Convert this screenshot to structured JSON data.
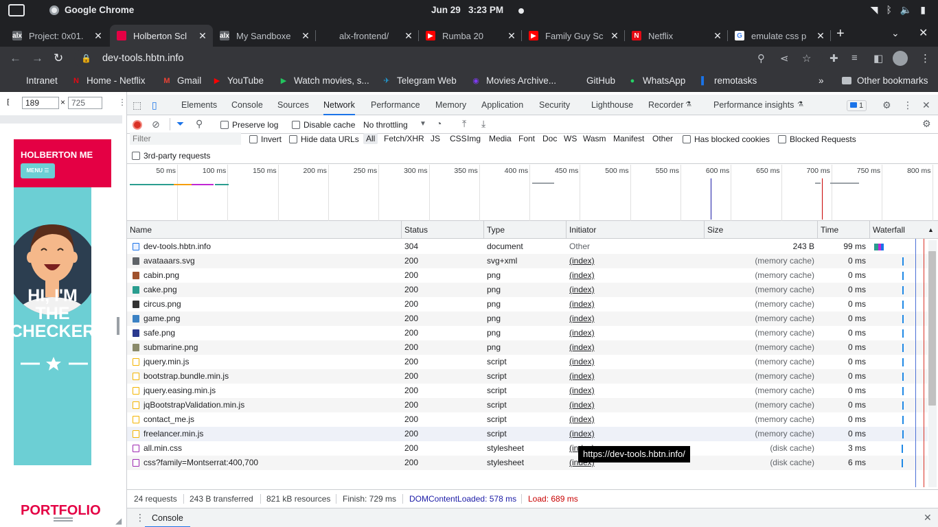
{
  "os": {
    "app_name": "Google Chrome",
    "date": "Jun 29",
    "time": "3:23 PM"
  },
  "browser": {
    "tabs": [
      {
        "title": "Project: 0x01.",
        "color": "#5f6368",
        "icon": "alx-icon",
        "glyph": "alx"
      },
      {
        "title": "Holberton Scl",
        "color": "#e40044",
        "icon": "holberton-icon",
        "glyph": ""
      },
      {
        "title": "My Sandboxe",
        "color": "#5f6368",
        "icon": "alx-icon",
        "glyph": "alx"
      },
      {
        "title": "alx-frontend/",
        "color": "#202124",
        "icon": "github-icon",
        "glyph": ""
      },
      {
        "title": "Rumba 20",
        "color": "#ff0000",
        "icon": "youtube-icon",
        "glyph": "▶"
      },
      {
        "title": "Family Guy Sc",
        "color": "#ff0000",
        "icon": "youtube-icon",
        "glyph": "▶"
      },
      {
        "title": "Netflix",
        "color": "#e50914",
        "icon": "netflix-icon",
        "glyph": "N"
      },
      {
        "title": "emulate css p",
        "color": "#ffffff",
        "icon": "google-icon",
        "glyph": "G"
      }
    ],
    "url": "dev-tools.hbtn.info",
    "bookmarks": [
      {
        "label": "Intranet",
        "icon": "alx-icon"
      },
      {
        "label": "Home - Netflix",
        "icon": "netflix-icon"
      },
      {
        "label": "Gmail",
        "icon": "gmail-icon"
      },
      {
        "label": "YouTube",
        "icon": "youtube-icon"
      },
      {
        "label": "Watch movies, s...",
        "icon": "play-icon"
      },
      {
        "label": "Telegram Web",
        "icon": "telegram-icon"
      },
      {
        "label": "Movies Archive...",
        "icon": "movies-icon"
      },
      {
        "label": "GitHub",
        "icon": "github-icon"
      },
      {
        "label": "WhatsApp",
        "icon": "whatsapp-icon"
      },
      {
        "label": "remotasks",
        "icon": "remotasks-icon"
      }
    ],
    "other_bookmarks": "Other bookmarks"
  },
  "device": {
    "width": "189",
    "height": "725",
    "separator": "×"
  },
  "emulated_page": {
    "brand": "HOLBERTON ME",
    "menu_label": "MENU ☰",
    "heading": [
      "HI, I'M",
      "THE",
      "CHECKER"
    ],
    "section": "PORTFOLIO"
  },
  "devtools": {
    "tabs": [
      "Elements",
      "Console",
      "Sources",
      "Network",
      "Performance",
      "Memory",
      "Application",
      "Security",
      "Lighthouse",
      "Recorder",
      "Performance insights"
    ],
    "active_tab": "Network",
    "issues_count": "1",
    "toolbar": {
      "preserve_log": "Preserve log",
      "disable_cache": "Disable cache",
      "throttling": "No throttling"
    },
    "filter": {
      "placeholder": "Filter",
      "invert": "Invert",
      "hide_data_urls": "Hide data URLs",
      "types": [
        "All",
        "Fetch/XHR",
        "JS",
        "CSS",
        "Img",
        "Media",
        "Font",
        "Doc",
        "WS",
        "Wasm",
        "Manifest",
        "Other"
      ],
      "has_blocked_cookies": "Has blocked cookies",
      "blocked_requests": "Blocked Requests",
      "third_party": "3rd-party requests"
    },
    "overview_ticks": [
      "50 ms",
      "100 ms",
      "150 ms",
      "200 ms",
      "250 ms",
      "300 ms",
      "350 ms",
      "400 ms",
      "450 ms",
      "500 ms",
      "550 ms",
      "600 ms",
      "650 ms",
      "700 ms",
      "750 ms",
      "800 ms"
    ],
    "columns": [
      "Name",
      "Status",
      "Type",
      "Initiator",
      "Size",
      "Time",
      "Waterfall"
    ],
    "requests": [
      {
        "name": "dev-tools.hbtn.info",
        "status": "304",
        "type": "document",
        "initiator": "Other",
        "size": "243 B",
        "time": "99 ms",
        "icon": "document-icon",
        "icolor": "#1a73e8"
      },
      {
        "name": "avataaars.svg",
        "status": "200",
        "type": "svg+xml",
        "initiator": "(index)",
        "size": "(memory cache)",
        "time": "0 ms",
        "icon": "image-icon",
        "icolor": "#5f6368"
      },
      {
        "name": "cabin.png",
        "status": "200",
        "type": "png",
        "initiator": "(index)",
        "size": "(memory cache)",
        "time": "0 ms",
        "icon": "image-icon",
        "icolor": "#a0522d"
      },
      {
        "name": "cake.png",
        "status": "200",
        "type": "png",
        "initiator": "(index)",
        "size": "(memory cache)",
        "time": "0 ms",
        "icon": "image-icon",
        "icolor": "#2a9d8f"
      },
      {
        "name": "circus.png",
        "status": "200",
        "type": "png",
        "initiator": "(index)",
        "size": "(memory cache)",
        "time": "0 ms",
        "icon": "image-icon",
        "icolor": "#333333"
      },
      {
        "name": "game.png",
        "status": "200",
        "type": "png",
        "initiator": "(index)",
        "size": "(memory cache)",
        "time": "0 ms",
        "icon": "image-icon",
        "icolor": "#3b82c4"
      },
      {
        "name": "safe.png",
        "status": "200",
        "type": "png",
        "initiator": "(index)",
        "size": "(memory cache)",
        "time": "0 ms",
        "icon": "image-icon",
        "icolor": "#2b3a8f"
      },
      {
        "name": "submarine.png",
        "status": "200",
        "type": "png",
        "initiator": "(index)",
        "size": "(memory cache)",
        "time": "0 ms",
        "icon": "image-icon",
        "icolor": "#8a8a6a"
      },
      {
        "name": "jquery.min.js",
        "status": "200",
        "type": "script",
        "initiator": "(index)",
        "size": "(memory cache)",
        "time": "0 ms",
        "icon": "script-icon",
        "icolor": "#f4b400"
      },
      {
        "name": "bootstrap.bundle.min.js",
        "status": "200",
        "type": "script",
        "initiator": "(index)",
        "size": "(memory cache)",
        "time": "0 ms",
        "icon": "script-icon",
        "icolor": "#f4b400"
      },
      {
        "name": "jquery.easing.min.js",
        "status": "200",
        "type": "script",
        "initiator": "(index)",
        "size": "(memory cache)",
        "time": "0 ms",
        "icon": "script-icon",
        "icolor": "#f4b400"
      },
      {
        "name": "jqBootstrapValidation.min.js",
        "status": "200",
        "type": "script",
        "initiator": "(index)",
        "size": "(memory cache)",
        "time": "0 ms",
        "icon": "script-icon",
        "icolor": "#f4b400"
      },
      {
        "name": "contact_me.js",
        "status": "200",
        "type": "script",
        "initiator": "(index)",
        "size": "(memory cache)",
        "time": "0 ms",
        "icon": "script-icon",
        "icolor": "#f4b400"
      },
      {
        "name": "freelancer.min.js",
        "status": "200",
        "type": "script",
        "initiator": "(index)",
        "size": "(memory cache)",
        "time": "0 ms",
        "icon": "script-icon",
        "icolor": "#f4b400"
      },
      {
        "name": "all.min.css",
        "status": "200",
        "type": "stylesheet",
        "initiator": "(index)",
        "size": "(disk cache)",
        "time": "3 ms",
        "icon": "stylesheet-icon",
        "icolor": "#9c27b0"
      },
      {
        "name": "css?family=Montserrat:400,700",
        "status": "200",
        "type": "stylesheet",
        "initiator": "(index)",
        "size": "(disk cache)",
        "time": "6 ms",
        "icon": "stylesheet-icon",
        "icolor": "#9c27b0"
      }
    ],
    "tooltip": "https://dev-tools.hbtn.info/",
    "summary": {
      "requests": "24 requests",
      "transferred": "243 B transferred",
      "resources": "821 kB resources",
      "finish": "Finish: 729 ms",
      "dom_content_loaded": "DOMContentLoaded: 578 ms",
      "load": "Load: 689 ms"
    },
    "drawer_tab": "Console"
  }
}
